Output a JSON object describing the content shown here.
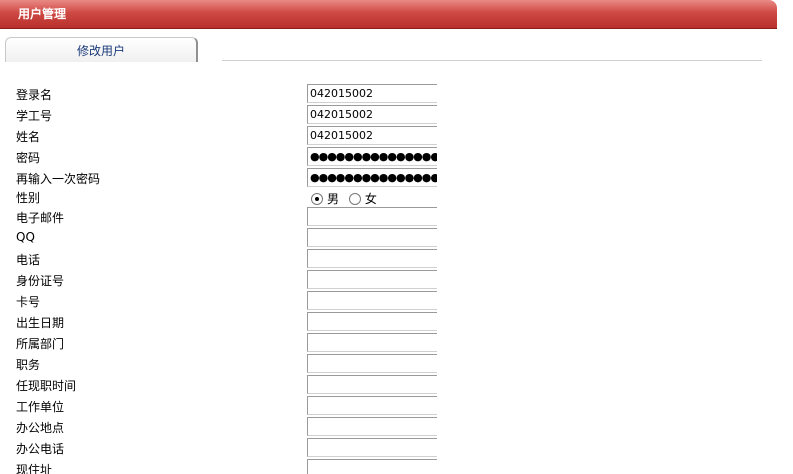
{
  "header": {
    "title": "用户管理"
  },
  "tabs": [
    {
      "label": "修改用户"
    }
  ],
  "form": {
    "login_name": {
      "label": "登录名",
      "value": "042015002"
    },
    "student_id": {
      "label": "学工号",
      "value": "042015002"
    },
    "name": {
      "label": "姓名",
      "value": "042015002"
    },
    "password": {
      "label": "密码",
      "value": "●●●●●●●●●●●●●●●●●●●●●●"
    },
    "password_confirm": {
      "label": "再输入一次密码",
      "value": "●●●●●●●●●●●●●●●●●●●●●●"
    },
    "gender": {
      "label": "性别",
      "options": [
        "男",
        "女"
      ],
      "selected": "男"
    },
    "email": {
      "label": "电子邮件",
      "value": ""
    },
    "qq": {
      "label": "QQ",
      "value": ""
    },
    "phone": {
      "label": "电话",
      "value": ""
    },
    "id_card": {
      "label": "身份证号",
      "value": ""
    },
    "card_no": {
      "label": "卡号",
      "value": ""
    },
    "birthday": {
      "label": "出生日期",
      "value": ""
    },
    "department": {
      "label": "所属部门",
      "value": ""
    },
    "position": {
      "label": "职务",
      "value": ""
    },
    "position_time": {
      "label": "任现职时间",
      "value": ""
    },
    "work_unit": {
      "label": "工作单位",
      "value": ""
    },
    "office_location": {
      "label": "办公地点",
      "value": ""
    },
    "office_phone": {
      "label": "办公电话",
      "value": ""
    },
    "address": {
      "label": "现住址",
      "value": ""
    }
  }
}
